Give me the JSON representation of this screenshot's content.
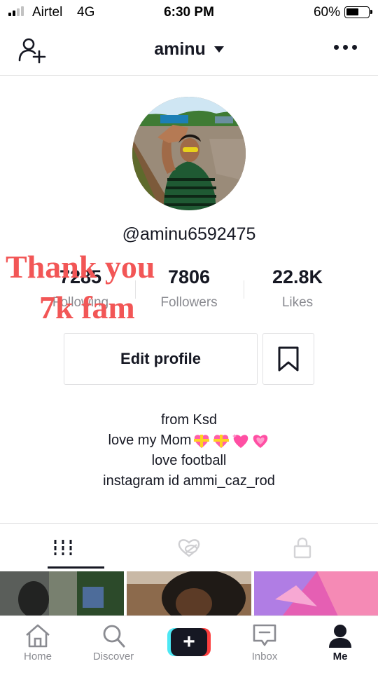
{
  "status_bar": {
    "carrier": "Airtel",
    "network": "4G",
    "time": "6:30 PM",
    "battery_percent": "60%",
    "battery_level": 0.6,
    "signal_bars_filled": 2,
    "signal_bars_total": 4
  },
  "header": {
    "username": "aminu",
    "add_user_icon": "add-user-icon",
    "dropdown_icon": "caret-down-icon",
    "more_icon": "more-dots-icon"
  },
  "profile": {
    "handle": "@aminu6592475",
    "stats": {
      "following": {
        "value": "7285",
        "label": "Following"
      },
      "followers": {
        "value": "7806",
        "label": "Followers"
      },
      "likes": {
        "value": "22.8K",
        "label": "Likes"
      }
    },
    "overlay_text": {
      "line1": "Thank you",
      "line2": "7k fam"
    },
    "edit_profile_label": "Edit profile",
    "bookmark_icon": "bookmark-icon",
    "bio": {
      "line1": "from Ksd",
      "line2": "love my Mom",
      "line3": "love football",
      "line4": "instagram id ammi_caz_rod"
    }
  },
  "tabs": [
    {
      "name": "videos",
      "icon": "grid-icon",
      "active": true
    },
    {
      "name": "liked",
      "icon": "liked-hidden-icon",
      "active": false
    },
    {
      "name": "private",
      "icon": "lock-icon",
      "active": false
    }
  ],
  "bottom_nav": {
    "home": "Home",
    "discover": "Discover",
    "inbox": "Inbox",
    "me": "Me",
    "create_label": "+"
  },
  "colors": {
    "text_primary": "#161823",
    "text_secondary": "#8a8b91",
    "overlay_red": "#f25656",
    "create_cyan": "#4de8f4",
    "create_red": "#fd3e3e",
    "divider": "#e3e3e4"
  }
}
